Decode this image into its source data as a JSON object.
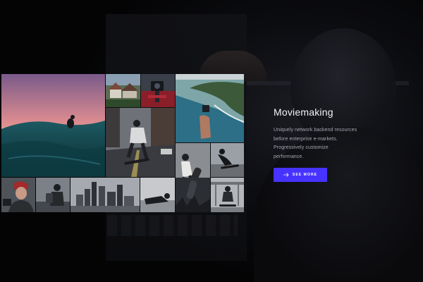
{
  "hero": {
    "title": "Moviemaking",
    "description_lines": [
      "Uniquely network backend resources",
      "before enterprise e-markets.",
      "Progressively customize",
      "performance."
    ],
    "cta": {
      "label": "SEE MORE",
      "icon": "arrow-right-icon"
    }
  },
  "gallery": {
    "tiles": [
      {
        "subject": "surfer-sunset"
      },
      {
        "subject": "houses-rooftops"
      },
      {
        "subject": "camera-gimbal"
      },
      {
        "subject": "coastline-drone"
      },
      {
        "subject": "skateboarder-street"
      },
      {
        "subject": "skateboard-trick"
      },
      {
        "subject": "skate-silhouette"
      },
      {
        "subject": "woman-red-beanie"
      },
      {
        "subject": "man-backpack"
      },
      {
        "subject": "city-skyline"
      },
      {
        "subject": "man-lying-down"
      },
      {
        "subject": "skateboard-legs"
      },
      {
        "subject": "skatepark-rider"
      }
    ]
  },
  "colors": {
    "accent": "#4733ff",
    "background": "#050507",
    "title_text": "#f2f3f6",
    "body_text": "#a6a8b2"
  }
}
